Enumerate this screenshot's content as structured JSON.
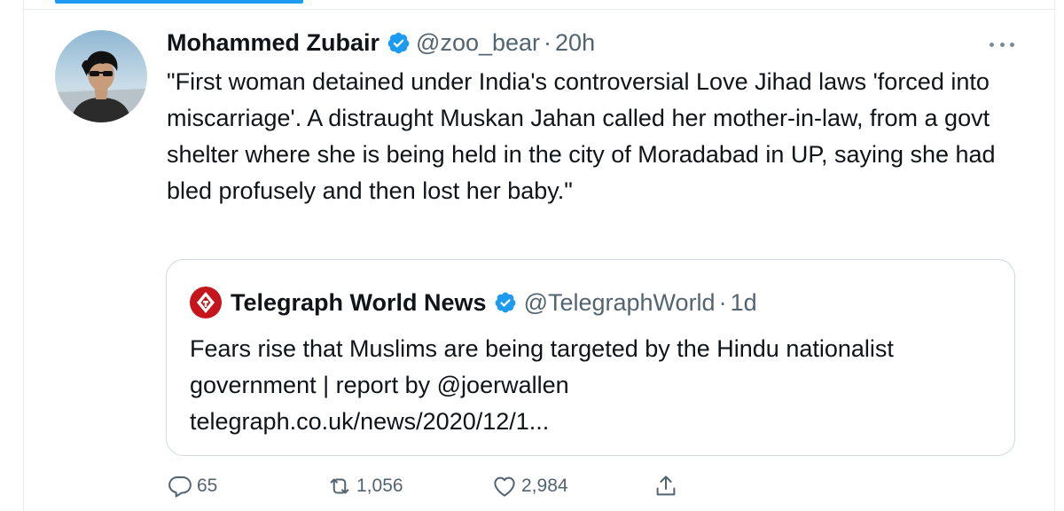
{
  "tweet": {
    "author_name": "Mohammed Zubair",
    "handle": "@zoo_bear",
    "separator": "·",
    "time": "20h",
    "text": "\"First woman detained under India's controversial Love Jihad laws 'forced into miscarriage'. A distraught Muskan Jahan called her mother-in-law, from a govt shelter where she is being held in the city of Moradabad in UP, saying she had bled profusely and then lost her baby.\"",
    "avatar_icon": "profile-photo",
    "verified_icon": "verified-badge-icon",
    "more_icon": "more-options-icon"
  },
  "quoted": {
    "author_name": "Telegraph World News",
    "handle": "@TelegraphWorld",
    "separator": "·",
    "time": "1d",
    "text_line1": "Fears rise that Muslims are being targeted by the Hindu nationalist",
    "text_line2": "government | report by @joerwallen",
    "link": "telegraph.co.uk/news/2020/12/1...",
    "logo_icon": "telegraph-logo-icon"
  },
  "actions": {
    "reply_count": "65",
    "retweet_count": "1,056",
    "like_count": "2,984",
    "reply_icon": "reply-icon",
    "retweet_icon": "retweet-icon",
    "like_icon": "heart-icon",
    "share_icon": "share-icon"
  },
  "colors": {
    "accent": "#1d9bf0",
    "text_primary": "#0f1419",
    "text_secondary": "#536471",
    "border": "#cfd9de",
    "telegraph_red": "#c4161c"
  }
}
